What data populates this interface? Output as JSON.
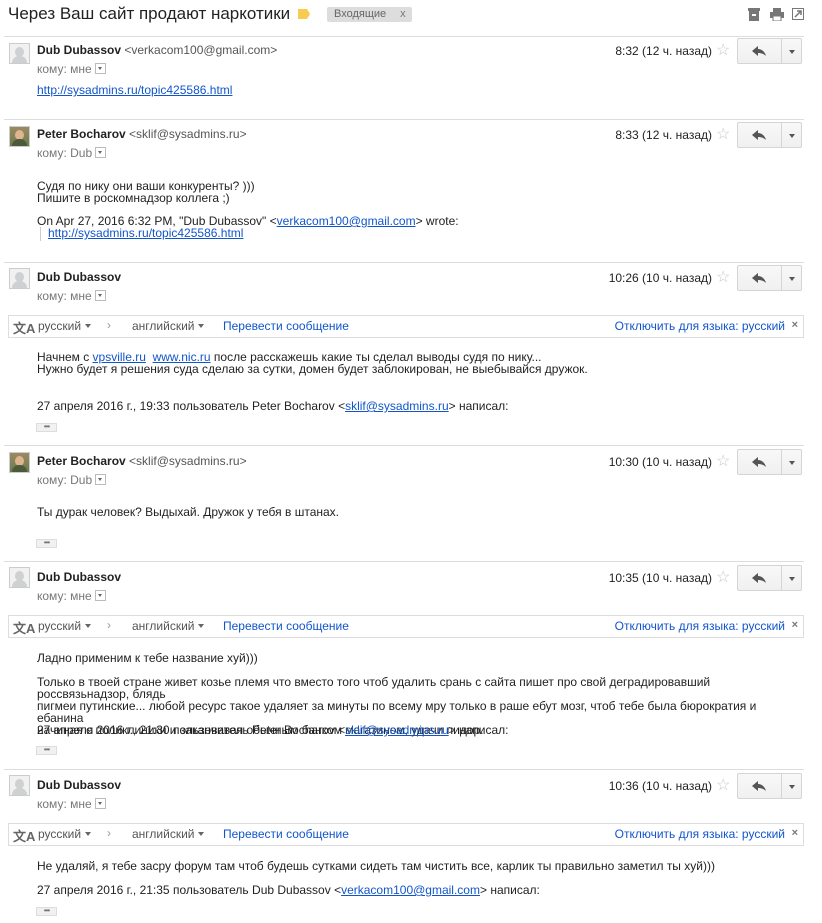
{
  "thread": {
    "subject": "Через Ваш сайт продают наркотики",
    "label": "Входящие",
    "label_close": "x"
  },
  "top_icons": [
    "archive-icon",
    "print-icon",
    "new-window-icon"
  ],
  "translate": {
    "icon": "文A",
    "source": "русский",
    "arrow": "›",
    "target": "английский",
    "translate_label": "Перевести сообщение",
    "off_label": "Отключить для языка: русский",
    "close": "×"
  },
  "messages": [
    {
      "sender": "Dub Dubassov",
      "email": "<verkacom100@gmail.com>",
      "to": "кому: мне",
      "time": "8:32 (12 ч. назад)",
      "link": "http://sysadmins.ru/topic425586.html"
    },
    {
      "sender": "Peter Bocharov",
      "email": "<sklif@sysadmins.ru>",
      "to": "кому: Dub",
      "time": "8:33 (12 ч. назад)",
      "line1": "Судя по нику они ваши конкуренты? )))",
      "line2": "Пишите в роскомнадзор коллега ;)",
      "quote_prefix": "On Apr 27, 2016 6:32 PM, \"Dub Dubassov\" <",
      "quote_email": "verkacom100@gmail.com",
      "quote_suffix": "> wrote:",
      "quote_link": "http://sysadmins.ru/topic425586.html"
    },
    {
      "sender": "Dub Dubassov",
      "to": "кому: мне",
      "time": "10:26 (10 ч. назад)",
      "l1_a": "Начнем с ",
      "l1_link1": "vpsville.ru",
      "l1_link2": "www.nic.ru",
      "l1_b": " после расскажешь какие ты сделал выводы судя по нику...",
      "line2": "Нужно будет я решения суда сделаю за сутки, домен будет заблокирован, не выебывайся дружок.",
      "attr_prefix": "27 апреля 2016 г., 19:33 пользователь Peter Bocharov <",
      "attr_email": "sklif@sysadmins.ru",
      "attr_suffix": "> написал:"
    },
    {
      "sender": "Peter Bocharov",
      "email": "<sklif@sysadmins.ru>",
      "to": "кому: Dub",
      "time": "10:30 (10 ч. назад)",
      "line1": "Ты дурак человек? Выдыхай. Дружок у тебя в штанах."
    },
    {
      "sender": "Dub Dubassov",
      "to": "кому: мне",
      "time": "10:35 (10 ч. назад)",
      "line1": "Ладно применим к тебе название хуй)))",
      "line2": "Только в твоей стране живет козье племя что вместо того чтоб удалить срань с сайта пишет про свой деградировавший россвязьнадзор, блядь",
      "line3": "пигмеи путинские... любой ресурс такое удаляет за минуты по всему мру только в раше ебут мозг, чтоб тебе была бюрократия и ебанина",
      "line4": "начиная с поликлиники и заканчивая обычным банком магазином, удачи пидор.",
      "attr_prefix": "27 апреля 2016 г., 21:30 пользователь Peter Bocharov <",
      "attr_email": "sklif@sysadmins.ru",
      "attr_suffix": "> написал:"
    },
    {
      "sender": "Dub Dubassov",
      "to": "кому: мне",
      "time": "10:36 (10 ч. назад)",
      "line1": "Не удаляй, я тебе засру форум там чтоб будешь сутками сидеть там чистить все, карлик ты правильно заметил ты хуй)))",
      "attr_prefix": "27 апреля 2016 г., 21:35 пользователь Dub Dubassov <",
      "attr_email": "verkacom100@gmail.com",
      "attr_suffix": "> написал:"
    }
  ],
  "ellipsis": "•••",
  "star": "☆"
}
